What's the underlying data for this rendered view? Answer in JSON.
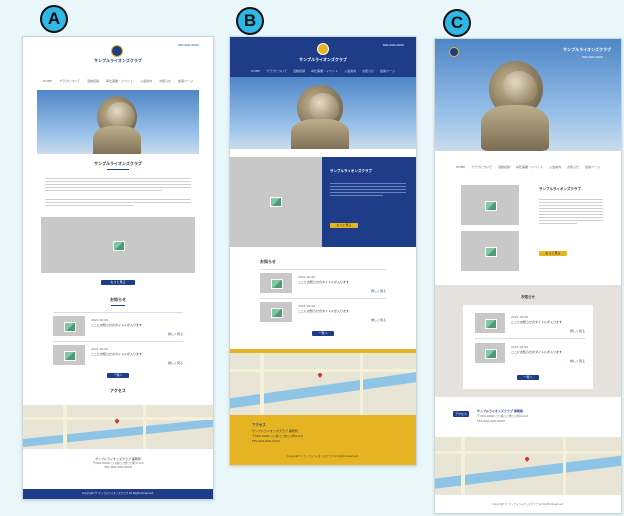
{
  "labels": [
    "A",
    "B",
    "C"
  ],
  "site": {
    "club_name": "サンプルライオンズクラブ",
    "phone": "000-000-0000",
    "nav": [
      "HOME",
      "クラブについて",
      "活動記録",
      "奉仕事業・イベント",
      "入会案内",
      "お知らせ",
      "会員ページ"
    ],
    "about_heading": "サンプルライオンズクラブ",
    "news_heading": "お知らせ",
    "access_heading": "アクセス",
    "more_button": "もっと見る",
    "list_button": "一覧へ",
    "news_items": [
      {
        "date": "2021.00.00",
        "title": "ここにお知らせのタイトルが入ります",
        "excerpt": "ここにお知らせの本文が入ります。ここにお知らせの本文が入ります。",
        "more": "詳しく見る"
      },
      {
        "date": "2021.00.00",
        "title": "ここにお知らせのタイトルが入ります",
        "excerpt": "ここにお知らせの本文が入ります。ここにお知らせの本文が入ります。",
        "more": "詳しく見る"
      }
    ],
    "footer_name": "サンプルライオンズクラブ 事務局",
    "footer_address": "〒000-0000 ○○県○○市○○町0-0-0",
    "footer_tel": "TEL:000-000-0000",
    "copyright": "Copyright © サンプルライオンズクラブ All Rights Reserved."
  },
  "colors": {
    "badge": "#2fb7e5",
    "navy": "#1f3c88",
    "yellow": "#e6b422",
    "beige": "#e5e1dc"
  }
}
